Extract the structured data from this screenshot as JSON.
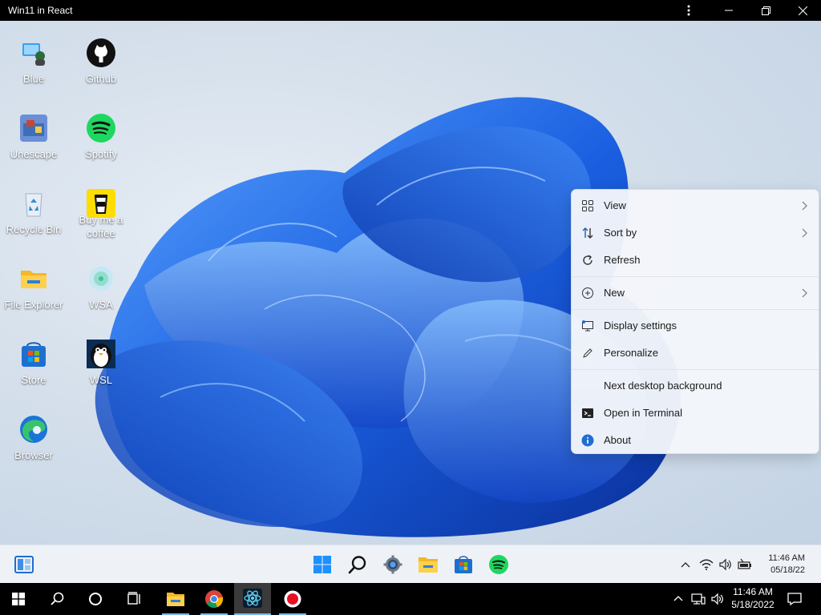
{
  "window": {
    "title": "Win11 in React"
  },
  "desktop": {
    "icons": [
      {
        "label": "Blue",
        "icon": "blue-app-icon"
      },
      {
        "label": "Github",
        "icon": "github-icon"
      },
      {
        "label": "Unescape",
        "icon": "unescape-icon"
      },
      {
        "label": "Spotify",
        "icon": "spotify-icon"
      },
      {
        "label": "Recycle Bin",
        "icon": "recycle-bin-icon"
      },
      {
        "label": "Buy me a coffee",
        "icon": "coffee-icon"
      },
      {
        "label": "File Explorer",
        "icon": "folder-icon"
      },
      {
        "label": "WSA",
        "icon": "wsa-icon"
      },
      {
        "label": "Store",
        "icon": "store-icon"
      },
      {
        "label": "WSL",
        "icon": "penguin-icon"
      },
      {
        "label": "Browser",
        "icon": "edge-icon"
      }
    ]
  },
  "context_menu": {
    "items": [
      {
        "label": "View",
        "icon": "grid-icon",
        "submenu": true
      },
      {
        "label": "Sort by",
        "icon": "sort-icon",
        "submenu": true
      },
      {
        "label": "Refresh",
        "icon": "refresh-icon",
        "submenu": false
      },
      {
        "label": "New",
        "icon": "plus-circle-icon",
        "submenu": true
      },
      {
        "label": "Display settings",
        "icon": "monitor-icon",
        "submenu": false
      },
      {
        "label": "Personalize",
        "icon": "pen-icon",
        "submenu": false
      },
      {
        "label": "Next desktop background",
        "icon": "",
        "submenu": false
      },
      {
        "label": "Open in Terminal",
        "icon": "terminal-icon",
        "submenu": false
      },
      {
        "label": "About",
        "icon": "info-icon",
        "submenu": false
      }
    ]
  },
  "taskbar": {
    "pinned": [
      "widgets-icon",
      "start-icon",
      "search-icon",
      "settings-icon",
      "explorer-icon",
      "store-icon",
      "spotify-icon"
    ],
    "clock": {
      "time": "11:46 AM",
      "date": "05/18/22"
    }
  },
  "host_taskbar": {
    "items": [
      "windows-start-icon",
      "search-icon",
      "cortana-icon",
      "task-view-icon",
      "file-explorer-icon",
      "chrome-icon",
      "react-app-icon",
      "record-icon"
    ],
    "clock": {
      "time": "11:46 AM",
      "date": "5/18/2022"
    }
  },
  "colors": {
    "accent": "#0067c0",
    "wallpaper_blue": "#1a5fe0"
  }
}
